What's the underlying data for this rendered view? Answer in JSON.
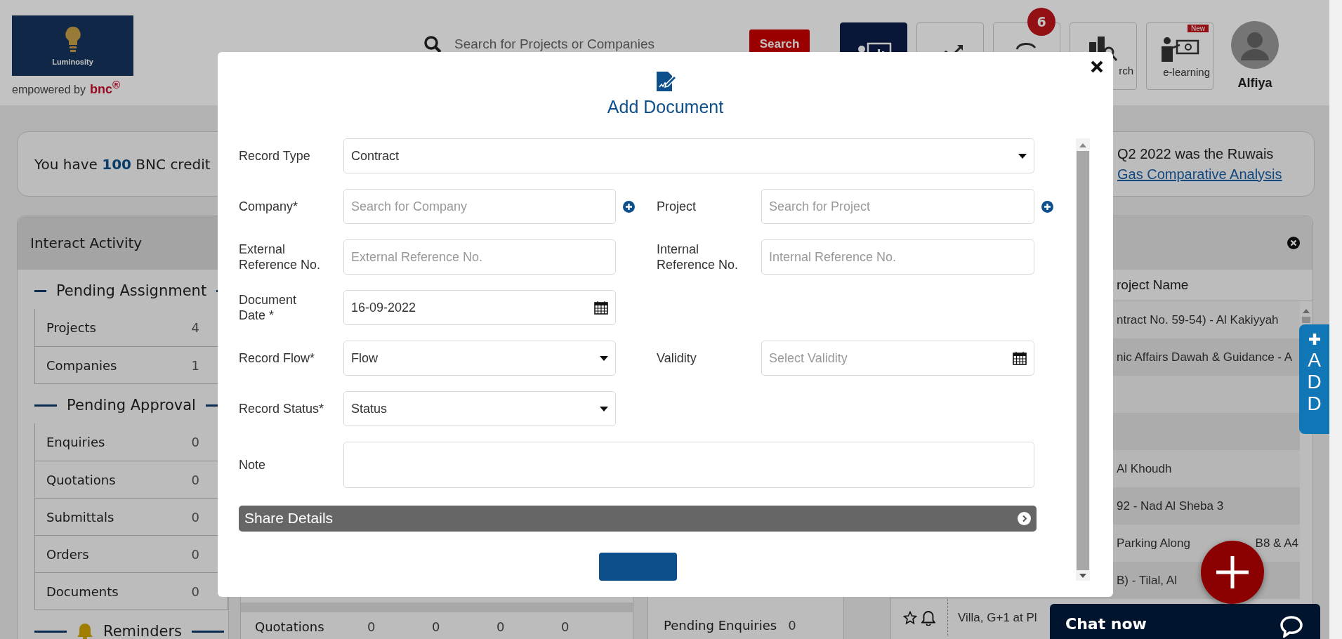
{
  "header": {
    "logo": {
      "brand": "Luminosity",
      "tagline": "empowered by",
      "company": "bnc$^{®}$"
    },
    "search": {
      "placeholder": "Search for Projects or Companies",
      "button": "Search"
    },
    "tiles": [
      {
        "kind": "presentation",
        "selected": true
      },
      {
        "kind": "growth",
        "selected": false
      },
      {
        "kind": "exchange",
        "selected": false,
        "badge": "6"
      },
      {
        "kind": "research",
        "selected": false,
        "label": "rch"
      },
      {
        "kind": "training",
        "selected": false,
        "label": "e-learning",
        "tag": "New"
      }
    ],
    "user": {
      "name": "Alfiya"
    }
  },
  "credits": {
    "text": "You have **100** BNC credit",
    "news": "Q2 2022 was the Ruwais",
    "news_link": "Gas Comparative Analysis"
  },
  "activity": {
    "title": "Interact Activity",
    "sections": [
      {
        "title": "Pending Assignment",
        "rows": [
          {
            "label": "Projects",
            "count": "4"
          },
          {
            "label": "Companies",
            "count": "1"
          }
        ]
      },
      {
        "title": "Pending Approval",
        "rows": [
          {
            "label": "Enquiries",
            "count": "0"
          },
          {
            "label": "Quotations",
            "count": "0"
          },
          {
            "label": "Submittals",
            "count": "0"
          },
          {
            "label": "Orders",
            "count": "0"
          },
          {
            "label": "Documents",
            "count": "0"
          }
        ]
      }
    ],
    "reminders": "Reminders"
  },
  "summary_row": {
    "label": "Quotations",
    "values": [
      "0",
      "0",
      "0",
      "0"
    ]
  },
  "enquiries": {
    "label": "Pending Enquiries",
    "count": "0"
  },
  "projects_panel": {
    "column": "roject Name",
    "rows": [
      {
        "kind": "plain",
        "text": "ntract No. 59-54) - Al Kakiyyah"
      },
      {
        "kind": "plain",
        "text": "nic Affairs Dawah & Guidance - A"
      },
      {
        "kind": "plain"
      },
      {
        "kind": "plain"
      },
      {
        "kind": "plain",
        "text": "Al Khoudh"
      },
      {
        "kind": "plain",
        "text": "92 - Nad Al Sheba 3"
      },
      {
        "kind": "plain",
        "text": "Parking Along",
        "text_end": "B8 & A4"
      },
      {
        "kind": "plain",
        "text": "B) - Tilal, Al"
      },
      {
        "kind": "actions",
        "text": "Villa, G+1 at Pl"
      }
    ]
  },
  "modal": {
    "title": "Add Document",
    "record_type": {
      "label": "Record Type",
      "value": "Contract"
    },
    "rows": [
      [
        {
          "label": "Company*",
          "kind": "search",
          "placeholder": "Search for Company"
        },
        {
          "label": "Project",
          "kind": "search",
          "placeholder": "Search for Project"
        }
      ],
      [
        {
          "label": "External\nReference No.",
          "kind": "text",
          "placeholder": "External Reference No."
        },
        {
          "label": "Internal\nReference No.",
          "kind": "text",
          "placeholder": "Internal Reference No."
        }
      ],
      [
        {
          "label": "Document\nDate *",
          "kind": "date",
          "value": "16-09-2022"
        }
      ],
      [
        {
          "label": "Record Flow*",
          "kind": "select",
          "value": "Flow"
        },
        {
          "label": "Validity",
          "kind": "date",
          "placeholder": "Select Validity"
        }
      ],
      [
        {
          "label": "Record Status*",
          "kind": "select",
          "value": "Status"
        }
      ]
    ],
    "note": {
      "label": "Note"
    },
    "share": "Share Details"
  },
  "add_tab": {
    "label": "ADD"
  },
  "chat": {
    "label": "Chat now"
  }
}
